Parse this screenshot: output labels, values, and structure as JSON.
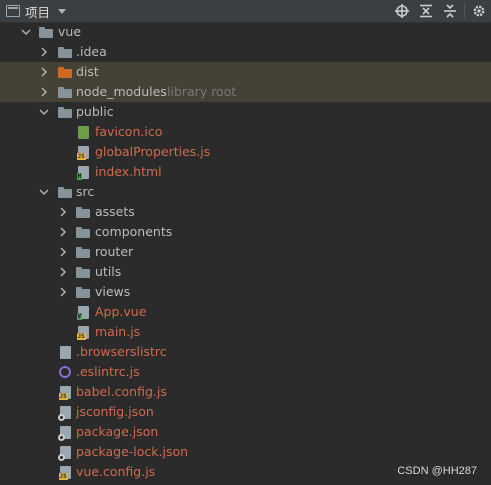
{
  "header": {
    "title": "项目",
    "icons": [
      "project-icon",
      "dropdown-caret-icon",
      "locate-icon",
      "expand-all-icon",
      "collapse-all-icon",
      "gear-icon"
    ]
  },
  "tree": {
    "root": "vue",
    "idea": ".idea",
    "dist": "dist",
    "node_modules": "node_modules",
    "node_modules_note": "library root",
    "public": "public",
    "favicon": "favicon.ico",
    "globalProperties": "globalProperties.js",
    "index_html": "index.html",
    "src": "src",
    "assets": "assets",
    "components": "components",
    "router": "router",
    "utils": "utils",
    "views": "views",
    "app_vue": "App.vue",
    "main_js": "main.js",
    "browserslistrc": ".browserslistrc",
    "eslintrc": ".eslintrc.js",
    "babel_config": "babel.config.js",
    "jsconfig": "jsconfig.json",
    "package_json": "package.json",
    "package_lock": "package-lock.json",
    "vue_config": "vue.config.js"
  },
  "file_type_tags": {
    "js": "JS",
    "html": "H",
    "vue": "V"
  },
  "watermark": "CSDN @HH287",
  "colors": {
    "background": "#2b2b2b",
    "header_bg": "#3c3f41",
    "folder": "#87939a",
    "excluded_folder": "#d2691e",
    "highlight_row": "#464135",
    "modified_text": "#cf6a4c"
  }
}
